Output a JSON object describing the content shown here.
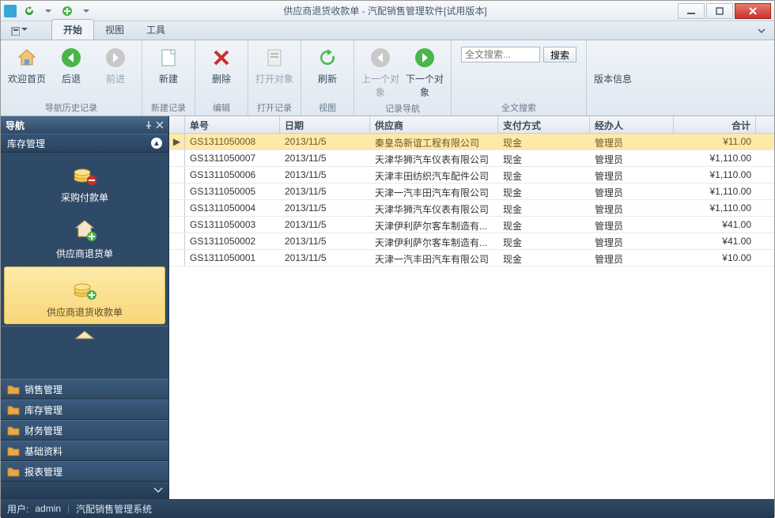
{
  "window": {
    "title": "供应商退货收款单 - 汽配销售管理软件[试用版本]"
  },
  "tabs": {
    "start": "开始",
    "view": "视图",
    "tools": "工具"
  },
  "ribbon": {
    "home": "欢迎首页",
    "back": "后退",
    "forward": "前进",
    "history_group": "导航历史记录",
    "new": "新建",
    "new_group": "新建记录",
    "delete": "删除",
    "edit_group": "编辑",
    "open": "打开对象",
    "open_group": "打开记录",
    "refresh": "刷新",
    "view_group": "视图",
    "prev": "上一个对象",
    "next": "下一个对象",
    "nav_group": "记录导航",
    "search_ph": "全文搜索...",
    "search_btn": "搜索",
    "search_group": "全文搜索",
    "version": "版本信息"
  },
  "nav": {
    "title": "导航",
    "section": "库存管理",
    "items": [
      {
        "label": "采购付款单"
      },
      {
        "label": "供应商退货单"
      },
      {
        "label": "供应商退货收款单"
      }
    ],
    "cats": [
      "销售管理",
      "库存管理",
      "财务管理",
      "基础资料",
      "报表管理"
    ]
  },
  "grid": {
    "cols": [
      "单号",
      "日期",
      "供应商",
      "支付方式",
      "经办人",
      "合计"
    ],
    "rows": [
      {
        "id": "GS1311050008",
        "date": "2013/11/5",
        "supplier": "秦皇岛新谊工程有限公司",
        "pay": "现金",
        "op": "管理员",
        "total": "¥11.00"
      },
      {
        "id": "GS1311050007",
        "date": "2013/11/5",
        "supplier": "天津华狮汽车仪表有限公司",
        "pay": "现金",
        "op": "管理员",
        "total": "¥1,110.00"
      },
      {
        "id": "GS1311050006",
        "date": "2013/11/5",
        "supplier": "天津丰田纺织汽车配件公司",
        "pay": "现金",
        "op": "管理员",
        "total": "¥1,110.00"
      },
      {
        "id": "GS1311050005",
        "date": "2013/11/5",
        "supplier": "天津一汽丰田汽车有限公司",
        "pay": "现金",
        "op": "管理员",
        "total": "¥1,110.00"
      },
      {
        "id": "GS1311050004",
        "date": "2013/11/5",
        "supplier": "天津华狮汽车仪表有限公司",
        "pay": "现金",
        "op": "管理员",
        "total": "¥1,110.00"
      },
      {
        "id": "GS1311050003",
        "date": "2013/11/5",
        "supplier": "天津伊利萨尔客车制造有...",
        "pay": "现金",
        "op": "管理员",
        "total": "¥41.00"
      },
      {
        "id": "GS1311050002",
        "date": "2013/11/5",
        "supplier": "天津伊利萨尔客车制造有...",
        "pay": "现金",
        "op": "管理员",
        "total": "¥41.00"
      },
      {
        "id": "GS1311050001",
        "date": "2013/11/5",
        "supplier": "天津一汽丰田汽车有限公司",
        "pay": "现金",
        "op": "管理员",
        "total": "¥10.00"
      }
    ]
  },
  "status": {
    "user_label": "用户:",
    "user": "admin",
    "app": "汽配销售管理系统"
  }
}
